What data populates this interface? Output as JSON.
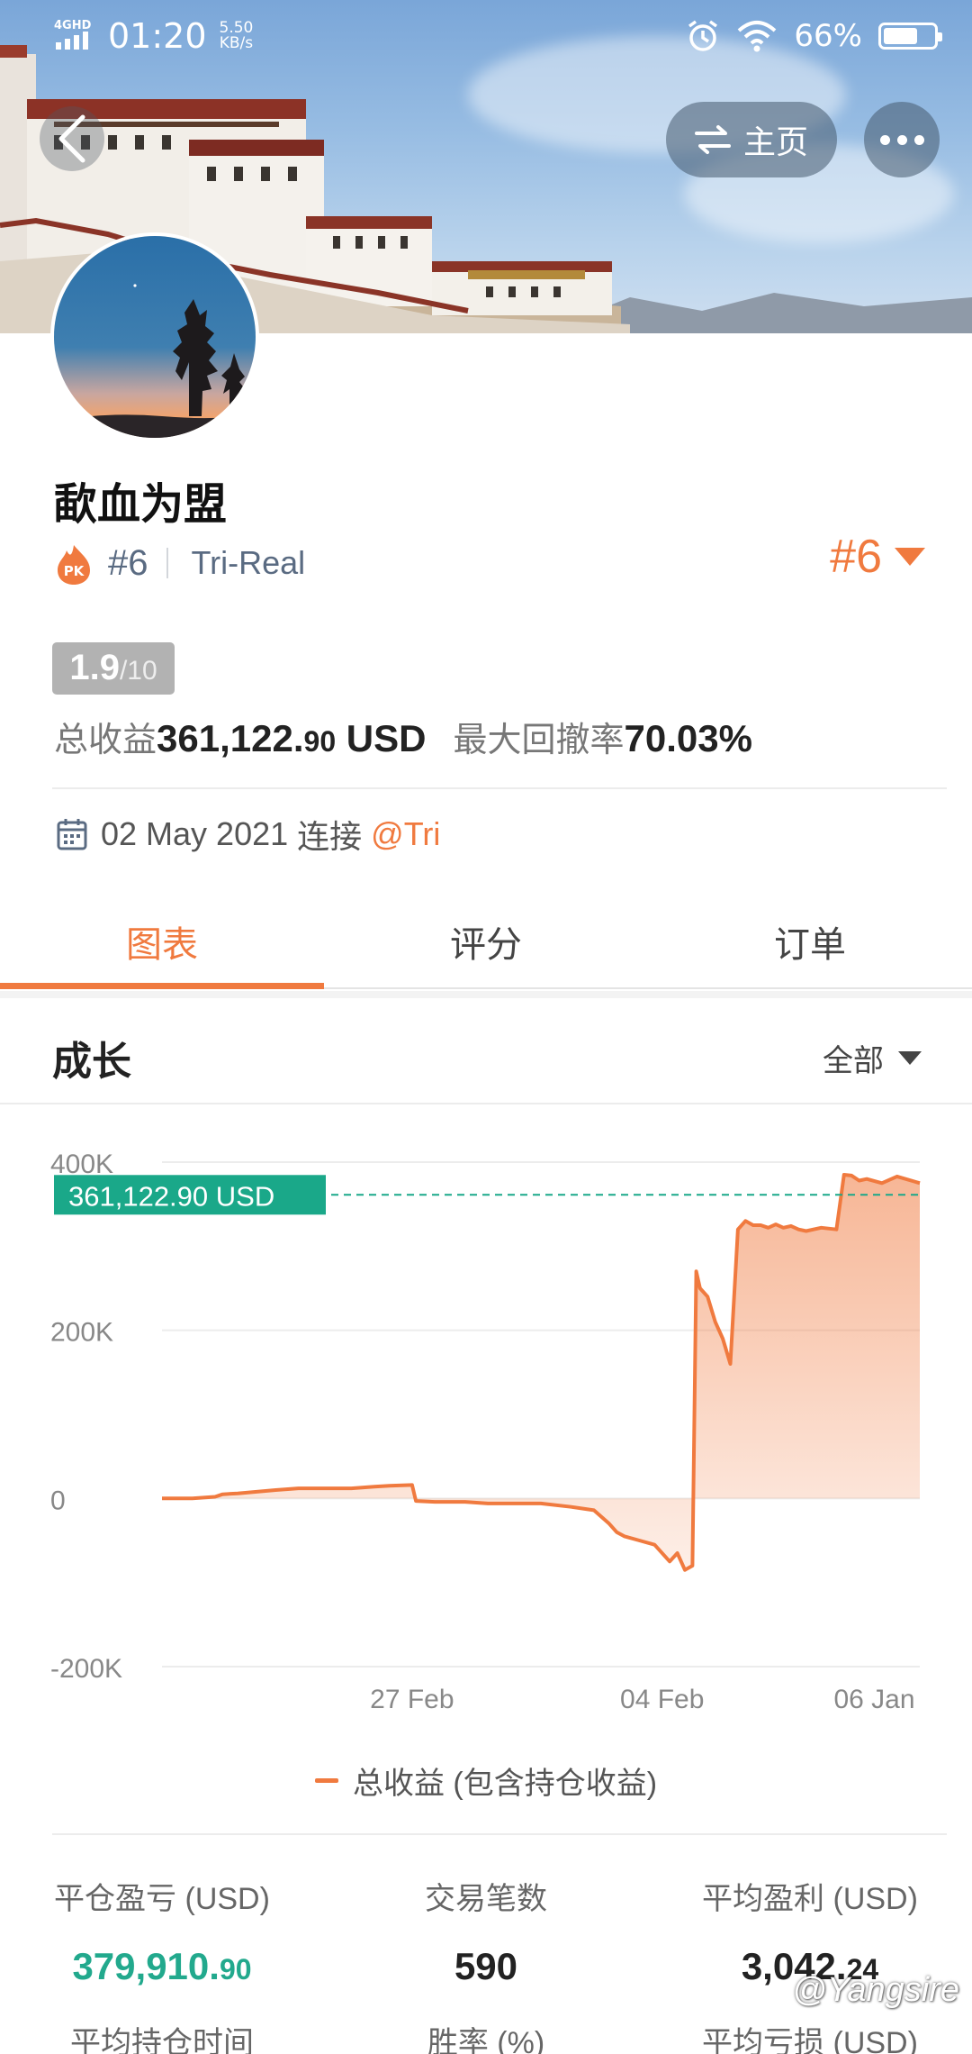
{
  "status_bar": {
    "network": "4GHD",
    "time": "01:20",
    "speed_value": "5.50",
    "speed_unit": "KB/s",
    "battery_pct": "66%",
    "battery_level": 0.66
  },
  "header": {
    "home_label": "主页"
  },
  "profile": {
    "name": "歃血为盟",
    "rank": "#6",
    "account_type": "Tri-Real",
    "rank_badge": "#6",
    "score": "1.9",
    "score_max": "/10",
    "total_profit_label": "总收益",
    "total_profit_main": "361,122.",
    "total_profit_dec": "90",
    "total_profit_currency": "USD",
    "max_drawdown_label": "最大回撤率",
    "max_drawdown_value": "70.03%",
    "connect_date": "02 May 2021",
    "connect_label": "连接",
    "connect_user": "@Tri"
  },
  "tabs": [
    {
      "label": "图表",
      "active": true
    },
    {
      "label": "评分",
      "active": false
    },
    {
      "label": "订单",
      "active": false
    }
  ],
  "growth": {
    "title": "成长",
    "filter": "全部"
  },
  "chart_data": {
    "type": "area",
    "title": "",
    "xlabel": "",
    "ylabel": "",
    "ylim": [
      -200000,
      400000
    ],
    "y_ticks": [
      "400K",
      "200K",
      "0",
      "-200K"
    ],
    "y_tick_values": [
      400000,
      200000,
      0,
      -200000
    ],
    "x_ticks": [
      "27 Feb",
      "04 Feb",
      "06 Jan"
    ],
    "x_tick_positions": [
      0.33,
      0.66,
      0.94
    ],
    "current_value_label": "361,122.90 USD",
    "current_value": 361122.9,
    "legend_position": "bottom",
    "line_color": "#f07a3f",
    "reference_line_color": "#1aa889",
    "series": [
      {
        "name": "总收益 (包含持仓收益)",
        "x": [
          0,
          0.04,
          0.07,
          0.08,
          0.1,
          0.15,
          0.18,
          0.25,
          0.28,
          0.3,
          0.33,
          0.335,
          0.36,
          0.4,
          0.43,
          0.5,
          0.54,
          0.57,
          0.59,
          0.6,
          0.61,
          0.63,
          0.65,
          0.67,
          0.68,
          0.69,
          0.7,
          0.705,
          0.71,
          0.72,
          0.73,
          0.74,
          0.75,
          0.76,
          0.77,
          0.78,
          0.79,
          0.8,
          0.81,
          0.82,
          0.83,
          0.84,
          0.85,
          0.87,
          0.89,
          0.9,
          0.91,
          0.92,
          0.93,
          0.95,
          0.97,
          1.0
        ],
        "y": [
          0,
          0,
          2000,
          5000,
          6000,
          10000,
          12000,
          12000,
          14000,
          15000,
          16000,
          -3000,
          -4000,
          -4000,
          -6000,
          -6000,
          -10000,
          -14000,
          -30000,
          -40000,
          -45000,
          -50000,
          -55000,
          -75000,
          -65000,
          -85000,
          -80000,
          270000,
          250000,
          240000,
          210000,
          190000,
          160000,
          320000,
          330000,
          325000,
          325000,
          322000,
          326000,
          322000,
          324000,
          320000,
          318000,
          322000,
          320000,
          385000,
          384000,
          378000,
          380000,
          375000,
          383000,
          375000
        ]
      }
    ]
  },
  "legend": {
    "label": "总收益 (包含持仓收益)"
  },
  "metrics": [
    {
      "label": "平仓盈亏 (USD)",
      "value_main": "379,910.",
      "value_dec": "90",
      "color": "#22a98d"
    },
    {
      "label": "交易笔数",
      "value_main": "590",
      "value_dec": "",
      "color": "#222222"
    },
    {
      "label": "平均盈利 (USD)",
      "value_main": "3,042.",
      "value_dec": "24",
      "color": "#222222"
    }
  ],
  "metrics_row2": [
    {
      "label": "平均持仓时间"
    },
    {
      "label": "胜率 (%)"
    },
    {
      "label": "平均亏损 (USD)"
    }
  ],
  "watermark": "@Yangsire"
}
